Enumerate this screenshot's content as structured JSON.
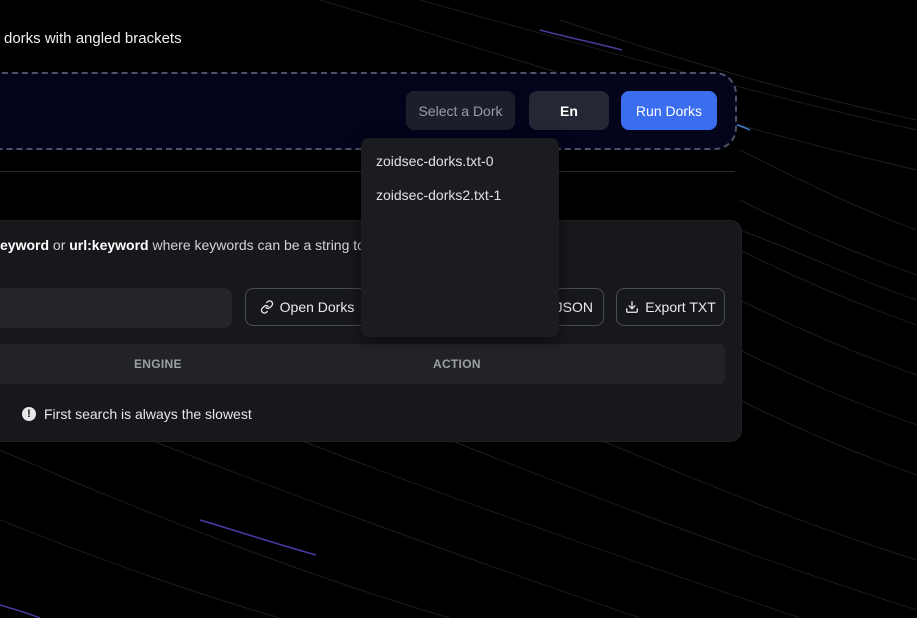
{
  "hint_text": "dorks with angled brackets",
  "dork_bar": {
    "select_label": "Select a Dork",
    "language_label": "En",
    "run_label": "Run Dorks"
  },
  "dropdown": {
    "items": [
      {
        "label": "zoidsec-dorks.txt-0"
      },
      {
        "label": "zoidsec-dorks2.txt-1"
      }
    ]
  },
  "info": {
    "keyword_a": "eyword",
    "or_text": " or ",
    "keyword_b": "url:keyword",
    "rest": " where keywords can be a string to"
  },
  "toolbar": {
    "open_label": "Open Dorks",
    "export_json_label": "JSON",
    "export_txt_label": "Export TXT"
  },
  "table": {
    "columns": [
      "ENGINE",
      "ACTION"
    ]
  },
  "notice": {
    "text": "First search is always the slowest"
  },
  "colors": {
    "accent": "#3a6df0",
    "background": "#000000",
    "panel": "#17181b"
  },
  "icons": {
    "open": "link-icon",
    "export": "download-icon",
    "notice": "alert-icon"
  }
}
